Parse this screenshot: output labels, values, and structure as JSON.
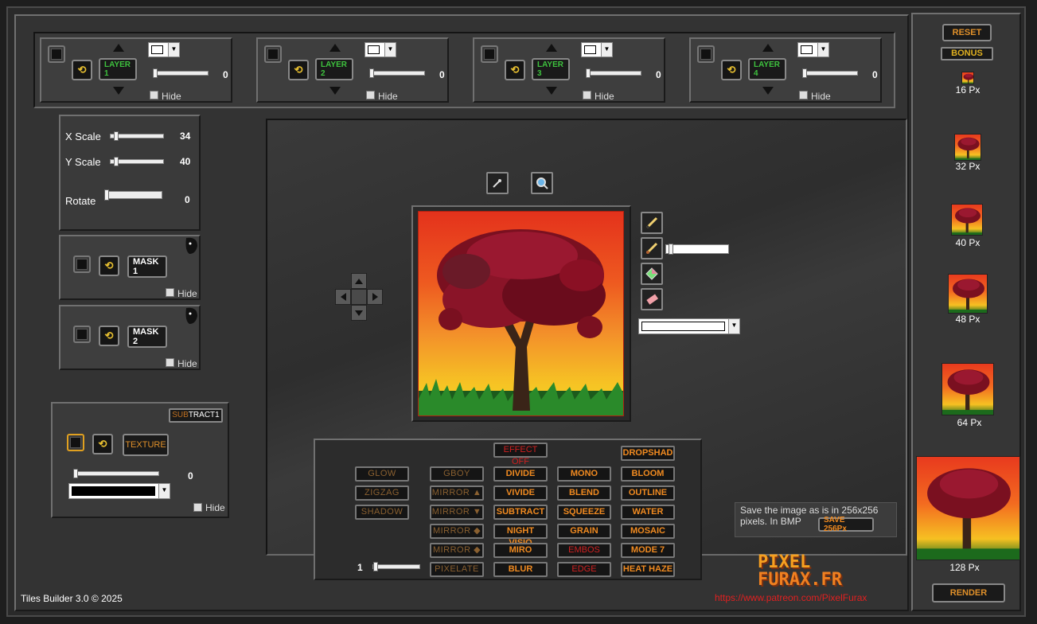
{
  "layers": [
    {
      "label": "LAYER 1",
      "slider_value": "0",
      "hide": "Hide"
    },
    {
      "label": "LAYER 2",
      "slider_value": "0",
      "hide": "Hide"
    },
    {
      "label": "LAYER 3",
      "slider_value": "0",
      "hide": "Hide"
    },
    {
      "label": "LAYER 4",
      "slider_value": "0",
      "hide": "Hide"
    }
  ],
  "transform": {
    "x_scale_label": "X Scale",
    "x_scale_value": "34",
    "y_scale_label": "Y Scale",
    "y_scale_value": "40",
    "rotate_label": "Rotate",
    "rotate_value": "0"
  },
  "masks": [
    {
      "label": "MASK 1",
      "hide": "Hide"
    },
    {
      "label": "MASK 2",
      "hide": "Hide"
    }
  ],
  "texture": {
    "mode_label": "SUBTRACT1",
    "mode_prefix": "SUB",
    "mode_suffix": "TRACT1",
    "button_label": "TEXTURE",
    "slider_value": "0",
    "hide": "Hide",
    "color": "#000000"
  },
  "effects": {
    "effect_off": "EFFECT OFF",
    "dropshad": "DROPSHAD",
    "col1": [
      "GLOW",
      "ZIGZAG",
      "SHADOW"
    ],
    "col2": [
      "GBOY",
      "MIRROR ▲",
      "MIRROR ▼",
      "MIRROR ◆",
      "MIRROR ◆",
      "PIXELATE"
    ],
    "col3": [
      "DIVIDE",
      "VIVIDE",
      "SUBTRACT",
      "NIGHT VISIO",
      "MIRO",
      "BLUR"
    ],
    "col4": [
      "MONO",
      "BLEND",
      "SQUEEZE",
      "GRAIN",
      "EMBOS",
      "EDGE"
    ],
    "col5": [
      "BLOOM",
      "OUTLINE",
      "WATER",
      "MOSAIC",
      "MODE 7",
      "HEAT HAZE"
    ],
    "strength_value": "1"
  },
  "save": {
    "text": "Save the image as is in 256x256 pixels. In BMP",
    "button": "SAVE 256Px"
  },
  "sidebar": {
    "reset": "RESET",
    "bonus": "BONUS",
    "sizes": [
      "16 Px",
      "32 Px",
      "40 Px",
      "48 Px",
      "64 Px",
      "128 Px"
    ],
    "render": "RENDER"
  },
  "footer": {
    "app_title": "Tiles Builder 3.0 © 2025",
    "logo_line1": "PIXEL",
    "logo_line2": "FURAX.FR",
    "url": "https://www.patreon.com/PixelFurax"
  },
  "colors": {
    "accent_orange": "#f08a20",
    "accent_green": "#3ec23e",
    "effect_off_red": "#d02020",
    "url_red": "#e02020"
  }
}
